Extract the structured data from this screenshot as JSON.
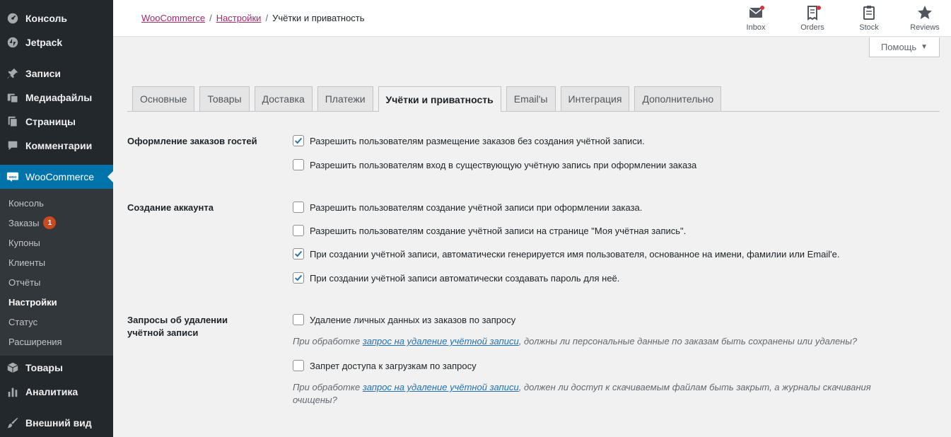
{
  "sidebar": {
    "top_items": [
      {
        "label": "Консоль",
        "icon": "dashboard-icon"
      },
      {
        "label": "Jetpack",
        "icon": "jetpack-icon"
      },
      {
        "label": "Записи",
        "icon": "pin-icon"
      },
      {
        "label": "Медиафайлы",
        "icon": "media-icon"
      },
      {
        "label": "Страницы",
        "icon": "pages-icon"
      },
      {
        "label": "Комментарии",
        "icon": "comment-icon"
      }
    ],
    "woocommerce": {
      "label": "WooCommerce",
      "icon_text": "woo"
    },
    "submenu": [
      {
        "label": "Консоль"
      },
      {
        "label": "Заказы",
        "badge": "1"
      },
      {
        "label": "Купоны"
      },
      {
        "label": "Клиенты"
      },
      {
        "label": "Отчёты"
      },
      {
        "label": "Настройки"
      },
      {
        "label": "Статус"
      },
      {
        "label": "Расширения"
      }
    ],
    "bottom_items": [
      {
        "label": "Товары",
        "icon": "box-icon"
      },
      {
        "label": "Аналитика",
        "icon": "chart-icon"
      },
      {
        "label": "Внешний вид",
        "icon": "brush-icon"
      }
    ]
  },
  "breadcrumb": {
    "link1": "WooCommerce",
    "link2": "Настройки",
    "current": "Учётки и приватность",
    "separator": "/"
  },
  "activity": {
    "inbox": "Inbox",
    "orders": "Orders",
    "stock": "Stock",
    "reviews": "Reviews"
  },
  "help": {
    "label": "Помощь",
    "caret": "▼"
  },
  "tabs": [
    "Основные",
    "Товары",
    "Доставка",
    "Платежи",
    "Учётки и приватность",
    "Email'ы",
    "Интеграция",
    "Дополнительно"
  ],
  "sections": {
    "guest": {
      "label": "Оформление заказов гостей",
      "opt1": "Разрешить пользователям размещение заказов без создания учётной записи.",
      "opt2": "Разрешить пользователям вход в существующую учётную запись при оформлении заказа"
    },
    "account": {
      "label": "Создание аккаунта",
      "opt1": "Разрешить пользователям создание учётной записи при оформлении заказа.",
      "opt2": "Разрешить пользователям создание учётной записи на странице \"Моя учётная запись\".",
      "opt3": "При создании учётной записи, автоматически генерируется имя пользователя, основанное на имени, фамилии или Email'е.",
      "opt4": "При создании учётной записи автоматически создавать пароль для неё."
    },
    "erasure": {
      "label": "Запросы об удалении учётной записи",
      "opt1": "Удаление личных данных из заказов по запросу",
      "desc1_pre": "При обработке ",
      "desc1_link": "запрос на удаление учётной записи",
      "desc1_post": ", должны ли персональные данные по заказам быть сохранены или удалены?",
      "opt2": "Запрет доступа к загрузкам по запросу",
      "desc2_pre": "При обработке ",
      "desc2_link": "запрос на удаление учётной записи",
      "desc2_post": ", должен ли доступ к скачиваемым файлам быть закрыт, а журналы скачивания очищены?"
    }
  }
}
